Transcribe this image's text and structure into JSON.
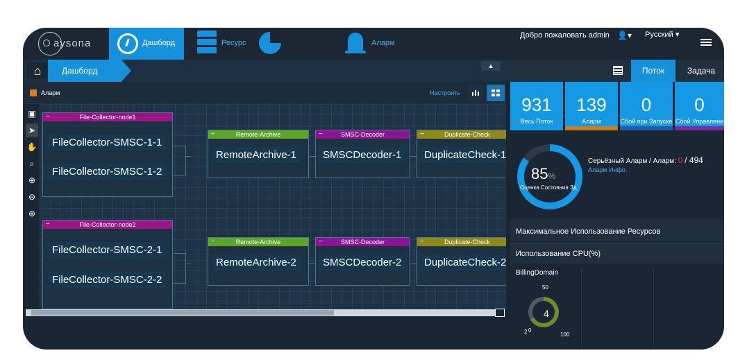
{
  "header": {
    "logo_text": "aysona",
    "nav": [
      {
        "label": "Дашборд",
        "icon": "dashboard-gauge-icon"
      },
      {
        "label": "Ресурс",
        "icon": "server-stack-icon"
      },
      {
        "label": "",
        "icon": "pie-chart-icon"
      },
      {
        "label": "Аларм",
        "icon": "bell-icon"
      }
    ],
    "welcome": "Добро пожаловать  admin",
    "user_menu": "▾",
    "language": "Русский ▾"
  },
  "breadcrumb": {
    "home_icon": "home-icon",
    "current": "Дашборд"
  },
  "right_tabs": [
    "Поток",
    "Задача"
  ],
  "canvas_toolbar": {
    "legend_label": "Аларм",
    "legend_color": "#d67d1a",
    "configure": "Настроить"
  },
  "nodes": [
    {
      "title": "File-Collector-node1",
      "color": "#9b1587",
      "items": [
        "FileCollector-SMSC-1-1",
        "FileCollector-SMSC-1-2"
      ]
    },
    {
      "title": "Remote-Archive",
      "color": "#5da526",
      "items": [
        "RemoteArchive-1"
      ]
    },
    {
      "title": "SMSC-Decoder",
      "color": "#8a1494",
      "items": [
        "SMSCDecoder-1"
      ]
    },
    {
      "title": "Duplicate-Check",
      "color": "#8d8a19",
      "items": [
        "DuplicateCheck-1"
      ]
    },
    {
      "title": "File-Collector-node2",
      "color": "#9b1587",
      "items": [
        "FileCollector-SMSC-2-1",
        "FileCollector-SMSC-2-2"
      ]
    },
    {
      "title": "Remote-Archive",
      "color": "#5da526",
      "items": [
        "RemoteArchive-2"
      ]
    },
    {
      "title": "SMSC-Decoder",
      "color": "#8a1494",
      "items": [
        "SMSCDecoder-2"
      ]
    },
    {
      "title": "Duplicate-Check",
      "color": "#8d8a19",
      "items": [
        "DuplicateCheck-2"
      ]
    }
  ],
  "stats": [
    {
      "value": "931",
      "label": "Весь Поток",
      "bar": "#1599e5"
    },
    {
      "value": "139",
      "label": "Аларм",
      "bar": "#c87d1e"
    },
    {
      "value": "0",
      "label": "Сбой при Запуске",
      "bar": "#1f5ea8"
    },
    {
      "value": "0",
      "label": "Сбой Управлени",
      "bar": "#7a2d9c"
    }
  ],
  "health": {
    "value": "85",
    "unit": "%",
    "fill_fraction": 0.85,
    "label": "Оценка Состояния Зд",
    "serious_label": "Серьёзный Аларм / Аларм:",
    "serious_count": "0",
    "alarm_count": "/ 494",
    "alarm_info": "Аларм Инфо. :"
  },
  "sections": [
    "Максимальное Использование Ресурсов",
    "Использование CPU(%)"
  ],
  "billing": {
    "label": "BillingDomain",
    "gauge_value": "4",
    "tick_min": "0",
    "tick_mid": "50",
    "tick_max": "100",
    "tick_low": "2"
  }
}
